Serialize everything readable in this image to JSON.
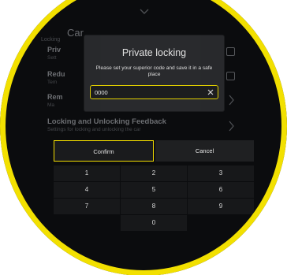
{
  "background": {
    "title": "Car",
    "subtitle": "Locking",
    "rows": [
      {
        "title": "Priv",
        "subtitle": "Sett",
        "control": "checkbox"
      },
      {
        "title": "Redu",
        "subtitle": "Tem",
        "control": "checkbox"
      },
      {
        "title": "Rem",
        "subtitle": "Ma",
        "control": "chevron"
      },
      {
        "title": "Locking and Unlocking Feedback",
        "subtitle": "Settings for locking and unlocking the car",
        "control": "chevron"
      }
    ]
  },
  "dialog": {
    "title": "Private locking",
    "message": "Please set your superior code and save it in a safe place",
    "input_value": "0000"
  },
  "buttons": {
    "confirm": "Confirm",
    "cancel": "Cancel"
  },
  "keypad": {
    "keys": [
      "1",
      "2",
      "3",
      "4",
      "5",
      "6",
      "7",
      "8",
      "9",
      "0"
    ]
  },
  "colors": {
    "accent": "#f2dc00",
    "ring": "#f2e000",
    "background": "#0b0c0e",
    "dialog": "#2a2b2e"
  },
  "icons": {
    "top": "chevron-down-icon",
    "clear": "close-icon",
    "row": "chevron-right-icon"
  }
}
